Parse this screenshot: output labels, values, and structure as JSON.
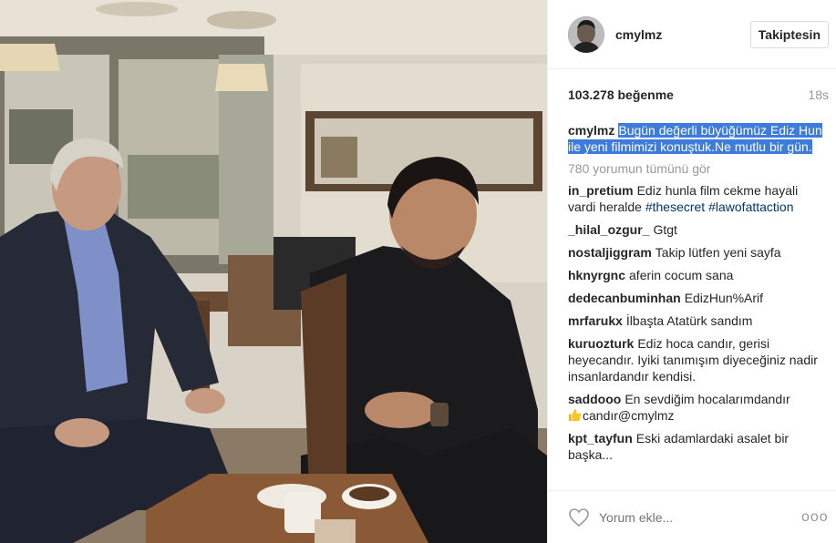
{
  "post": {
    "username": "cmylmz",
    "follow_label": "Takiptesin",
    "likes": "103.278 beğenme",
    "time": "18s",
    "caption": {
      "author": "cmylmz",
      "text": "Bugün değerli büyüğümüz Ediz Hun ile yeni filmimizi konuştuk.Ne mutlu bir gün."
    },
    "view_all": "780 yorumun tümünü gör",
    "comments": [
      {
        "author": "in_pretium",
        "text": "Ediz hunla film cekme hayali vardi heralde",
        "tags": [
          "#thesecret",
          "#lawofattaction"
        ]
      },
      {
        "author": "_hilal_ozgur_",
        "text": "Gtgt"
      },
      {
        "author": "nostaljiggram",
        "text": "Takip lütfen yeni sayfa"
      },
      {
        "author": "hknyrgnc",
        "text": "aferin cocum sana"
      },
      {
        "author": "dedecanbuminhan",
        "text": "EdizHun%Arif"
      },
      {
        "author": "mrfarukx",
        "text": "İlbaşta Atatürk sandım"
      },
      {
        "author": "kuruozturk",
        "text": "Ediz hoca candır, gerisi heyecandır. Iyiki tanımışım diyeceğiniz nadir insanlardandır kendisi."
      },
      {
        "author": "saddooo",
        "text": "En sevdiğim hocalarımdandır",
        "text2": "candır@cmylmz"
      },
      {
        "author": "kpt_tayfun",
        "text": "Eski adamlardaki asalet bir başka..."
      }
    ],
    "comment_placeholder": "Yorum ekle...",
    "more_label": "ooo"
  },
  "colors": {
    "highlight": "#3d7bdc",
    "hashtag": "#003569",
    "muted": "#999999"
  },
  "icons": {
    "like": "heart-icon",
    "more": "more-options-icon",
    "emoji": "thumbs-up-emoji"
  }
}
